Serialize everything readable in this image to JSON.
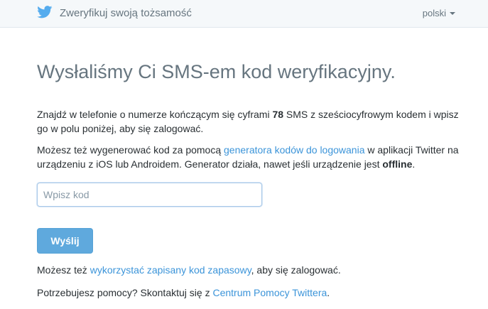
{
  "header": {
    "title": "Zweryfikuj swoją tożsamość",
    "language": "polski"
  },
  "main": {
    "heading": "Wysłaliśmy Ci SMS-em kod weryfikacyjny.",
    "p1": {
      "before": "Znajdź w telefonie o numerze kończącym się cyframi ",
      "digits": "78",
      "after": " SMS z sześciocyfrowym kodem i wpisz go w polu poniżej, aby się zalogować."
    },
    "p2": {
      "before": "Możesz też wygenerować kod za pomocą ",
      "link": "generatora kodów do logowania",
      "middle": " w aplikacji Twitter na urządzeniu z iOS lub Androidem. Generator działa, nawet jeśli urządzenie jest ",
      "bold": "offline",
      "after": "."
    },
    "code_input": {
      "placeholder": "Wpisz kod",
      "value": ""
    },
    "submit_label": "Wyślij",
    "p3": {
      "before": "Możesz też ",
      "link": "wykorzystać zapisany kod zapasowy",
      "after": ", aby się zalogować."
    },
    "p4": {
      "before": "Potrzebujesz pomocy? Skontaktuj się z ",
      "link": "Centrum Pomocy Twittera",
      "after": "."
    }
  },
  "colors": {
    "accent": "#3b94d9",
    "button": "#5fa9dd"
  },
  "icons": {
    "logo": "twitter-bird-icon"
  }
}
